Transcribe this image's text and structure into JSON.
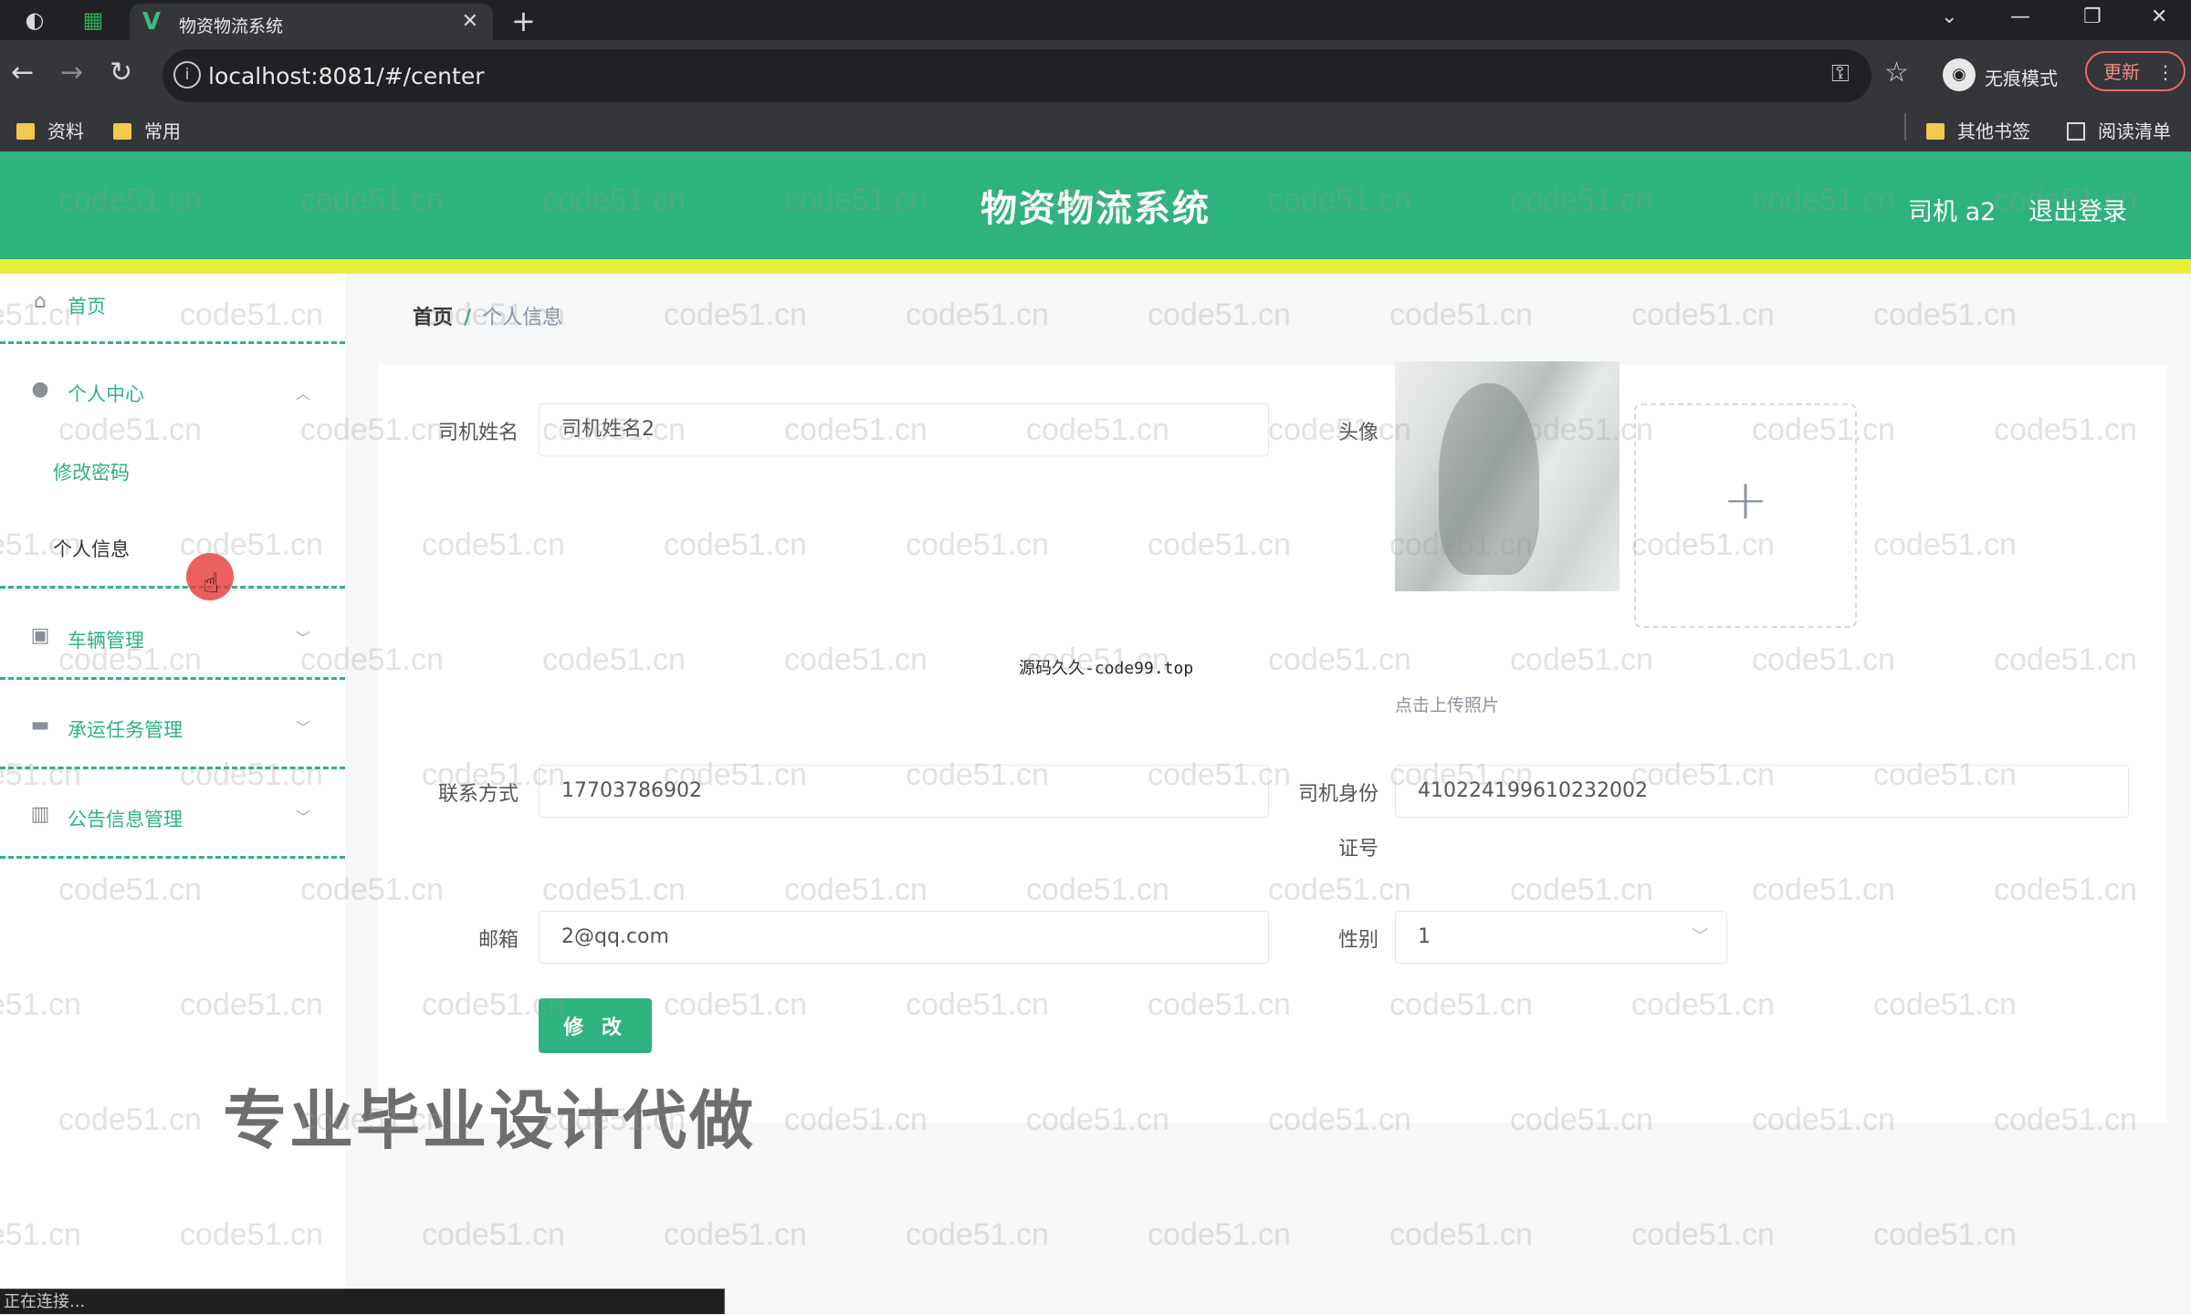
{
  "browser": {
    "tab_title": "物资物流系统",
    "url": "localhost:8081/#/center",
    "incognito_label": "无痕模式",
    "update_label": "更新",
    "bookmarks": [
      "资料",
      "常用"
    ],
    "other_bookmarks": "其他书签",
    "reading_list": "阅读清单",
    "status": "正在连接..."
  },
  "header": {
    "title": "物资物流系统",
    "user": "司机 a2",
    "logout": "退出登录"
  },
  "sidebar": {
    "home": "首页",
    "personal_center": "个人中心",
    "change_password": "修改密码",
    "personal_info": "个人信息",
    "vehicle_mgmt": "车辆管理",
    "task_mgmt": "承运任务管理",
    "notice_mgmt": "公告信息管理"
  },
  "breadcrumb": {
    "home": "首页",
    "separator": "/",
    "current": "个人信息"
  },
  "form": {
    "driver_name_label": "司机姓名",
    "driver_name_value": "司机姓名2",
    "avatar_label": "头像",
    "upload_hint": "点击上传照片",
    "phone_label": "联系方式",
    "phone_value": "17703786902",
    "id_label_line1": "司机身份",
    "id_label_line2": "证号",
    "id_value": "410224199610232002",
    "email_label": "邮箱",
    "email_value": "2@qq.com",
    "gender_label": "性别",
    "gender_value": "1",
    "submit_label": "修 改"
  },
  "overlay_text": "源码久久-code99.top",
  "promo_text": "专业毕业设计代做",
  "watermark": "code51.cn",
  "colors": {
    "primary": "#2db37d",
    "accent_bar": "#e8ef3a"
  }
}
